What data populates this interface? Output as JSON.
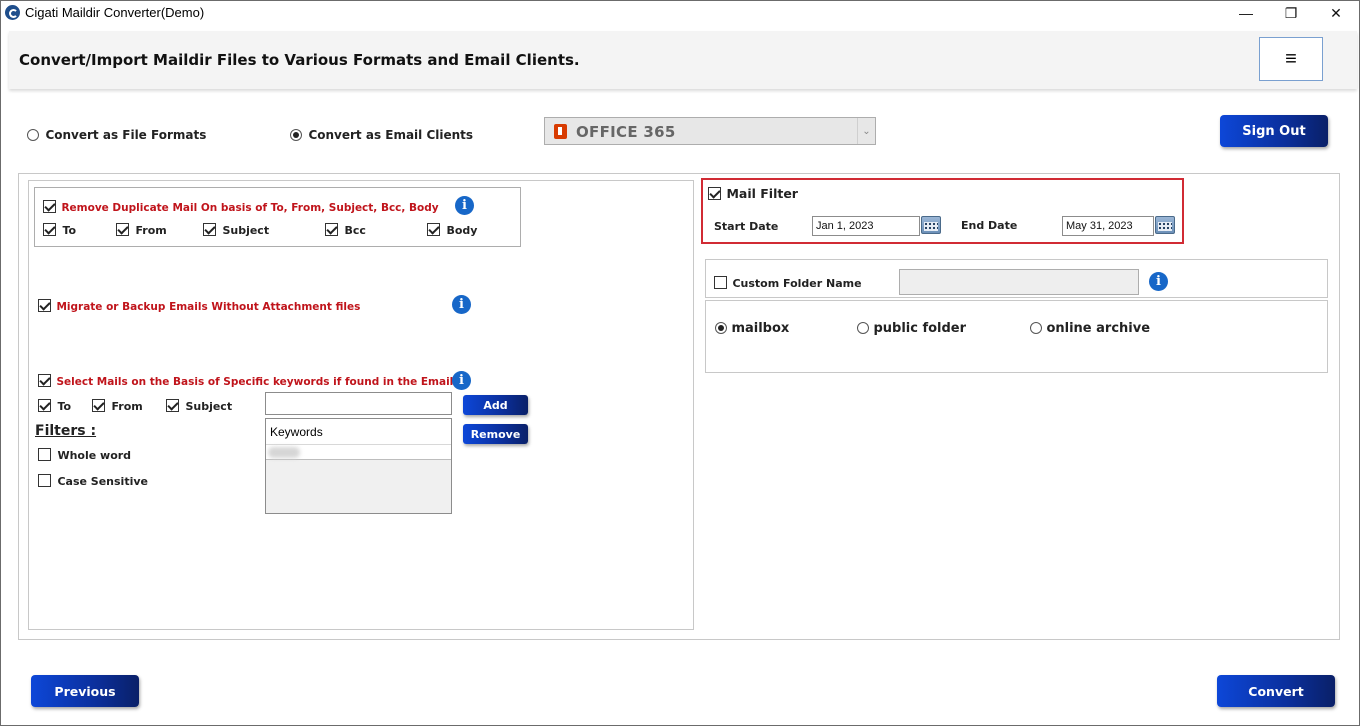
{
  "window": {
    "title": "Cigati Maildir Converter(Demo)",
    "controls": {
      "minimize": "—",
      "maximize": "❐",
      "close": "✕"
    }
  },
  "header": {
    "title": "Convert/Import Maildir Files to Various Formats and Email Clients.",
    "menu_icon": "≡"
  },
  "mode": {
    "option_file_formats": "Convert as File Formats",
    "option_email_clients": "Convert as Email Clients",
    "selected": "email_clients"
  },
  "target_client": {
    "selected": "OFFICE 365",
    "arrow": "⌄"
  },
  "sign_out_label": "Sign Out",
  "duplicates": {
    "label": "Remove Duplicate Mail On basis of To, From, Subject, Bcc, Body",
    "checked": true,
    "fields": [
      {
        "label": "To",
        "checked": true
      },
      {
        "label": "From",
        "checked": true
      },
      {
        "label": "Subject",
        "checked": true
      },
      {
        "label": "Bcc",
        "checked": true
      },
      {
        "label": "Body",
        "checked": true
      }
    ]
  },
  "no_attachment": {
    "label": "Migrate or Backup Emails Without Attachment files",
    "checked": true
  },
  "keywords": {
    "label": "Select Mails on the Basis of Specific keywords if found in the Email",
    "checked": true,
    "fields": [
      {
        "label": "To",
        "checked": true
      },
      {
        "label": "From",
        "checked": true
      },
      {
        "label": "Subject",
        "checked": true
      }
    ],
    "input_value": "",
    "add_label": "Add",
    "remove_label": "Remove",
    "list_header": "Keywords",
    "filters_title": "Filters :",
    "whole_word": "Whole word",
    "case_sensitive": "Case Sensitive"
  },
  "mail_filter": {
    "label": "Mail Filter",
    "checked": true,
    "start_label": "Start Date",
    "start_value": "Jan 1, 2023",
    "end_label": "End Date",
    "end_value": "May 31, 2023"
  },
  "custom_folder": {
    "label": "Custom Folder Name",
    "checked": false,
    "value": ""
  },
  "target_folder": {
    "options": [
      "mailbox",
      "public folder",
      "online archive"
    ],
    "selected": "mailbox"
  },
  "nav": {
    "previous_label": "Previous",
    "convert_label": "Convert"
  },
  "colors": {
    "accent_button": "#0b2f9c",
    "warning_text": "#c0141b",
    "highlight_border": "#d12b34",
    "info_icon": "#1767c8"
  }
}
